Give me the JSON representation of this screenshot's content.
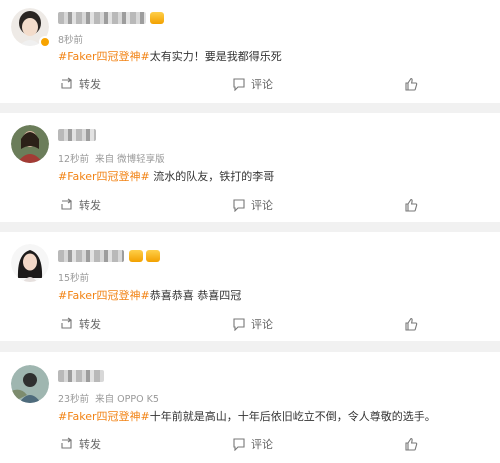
{
  "posts": [
    {
      "time": "8秒前",
      "topic": "#Faker四冠登神#",
      "text": "太有实力！要是我都得乐死",
      "actions": {
        "repost": "转发",
        "comment": "评论"
      }
    },
    {
      "time": "12秒前",
      "source": "来自 微博轻享版",
      "topic": "#Faker四冠登神#",
      "text": " 流水的队友，铁打的李哥",
      "actions": {
        "repost": "转发",
        "comment": "评论"
      }
    },
    {
      "time": "15秒前",
      "topic": "#Faker四冠登神#",
      "text": "恭喜恭喜 恭喜四冠",
      "actions": {
        "repost": "转发",
        "comment": "评论"
      }
    },
    {
      "time": "23秒前",
      "source": "来自 OPPO K5",
      "topic": "#Faker四冠登神#",
      "text": "十年前就是高山，十年后依旧屹立不倒，令人尊敬的选手。",
      "actions": {
        "repost": "转发",
        "comment": "评论"
      }
    }
  ],
  "colors": {
    "topic": "#f28314",
    "meta": "#999999",
    "background": "#f1f1f1"
  },
  "icons": [
    "repost-icon",
    "comment-icon",
    "like-icon",
    "vip-badge-icon"
  ]
}
